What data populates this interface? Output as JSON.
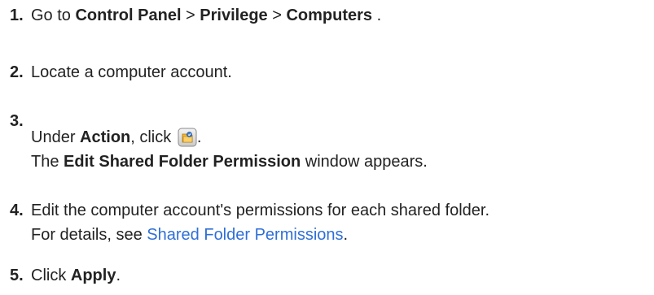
{
  "steps": [
    {
      "number": "1.",
      "text_go_to": "Go to ",
      "crumb_1": "Control Panel",
      "separator_1": " > ",
      "crumb_2": "Privilege",
      "separator_2": " > ",
      "crumb_3": "Computers",
      "end": " ."
    },
    {
      "number": "2.",
      "text": "Locate a computer account."
    },
    {
      "number": "3.",
      "under": "Under ",
      "action_label": "Action",
      "click_text": ", click ",
      "icon": "edit-shared-folder-permission-icon",
      "after_icon": ".",
      "result_prefix": "The ",
      "window_name": "Edit Shared Folder Permission",
      "result_suffix": " window appears."
    },
    {
      "number": "4.",
      "line1": "Edit the computer account's permissions for each shared folder.",
      "line2_prefix": "For details, see ",
      "link_text": "Shared Folder Permissions",
      "line2_suffix": "."
    },
    {
      "number": "5.",
      "click_prefix": "Click ",
      "button_name": "Apply",
      "suffix": "."
    }
  ],
  "colors": {
    "text": "#222222",
    "link": "#2f6fd6"
  }
}
